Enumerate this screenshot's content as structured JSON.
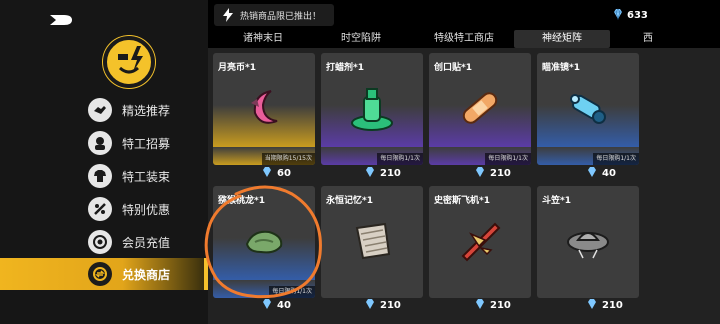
{
  "notice": {
    "text": "热销商品限已推出！"
  },
  "currency": {
    "amount": "633",
    "icon": "gem-icon"
  },
  "sidebar": {
    "items": [
      {
        "label": "精选推荐",
        "icon": "handshake-icon",
        "active": false
      },
      {
        "label": "特工招募",
        "icon": "agent-icon",
        "active": false
      },
      {
        "label": "特工装束",
        "icon": "outfit-icon",
        "active": false
      },
      {
        "label": "特别优惠",
        "icon": "discount-icon",
        "active": false
      },
      {
        "label": "会员充值",
        "icon": "member-icon",
        "active": false
      },
      {
        "label": "兑换商店",
        "icon": "exchange-icon",
        "active": true
      }
    ]
  },
  "tabs": [
    {
      "label": "诸神末日",
      "active": false
    },
    {
      "label": "时空陷阱",
      "active": false
    },
    {
      "label": "特级特工商店",
      "active": false
    },
    {
      "label": "神经矩阵",
      "active": true
    },
    {
      "label": "西",
      "active": false
    }
  ],
  "items": [
    {
      "name": "月亮币*1",
      "limit": "当期限购15/15次",
      "price": "60",
      "bg": "yellow",
      "icon": "moon-coin-icon"
    },
    {
      "name": "打蜡剂*1",
      "limit": "每日限购1/1次",
      "price": "210",
      "bg": "purple",
      "icon": "wax-bottle-icon"
    },
    {
      "name": "创口贴*1",
      "limit": "每日限购1/1次",
      "price": "210",
      "bg": "purple",
      "icon": "bandage-icon"
    },
    {
      "name": "瞄准镜*1",
      "limit": "每日限购1/1次",
      "price": "40",
      "bg": "blue",
      "icon": "scope-icon"
    },
    {
      "name": "猕猴桃龙*1",
      "limit": "每日限购1/1次",
      "price": "40",
      "bg": "blue",
      "icon": "kiwi-dragon-icon"
    },
    {
      "name": "永恒记忆*1",
      "limit": "",
      "price": "210",
      "bg": "none",
      "icon": "memory-icon"
    },
    {
      "name": "史密斯飞机*1",
      "limit": "",
      "price": "210",
      "bg": "none",
      "icon": "plane-icon"
    },
    {
      "name": "斗笠*1",
      "limit": "",
      "price": "210",
      "bg": "none",
      "icon": "hat-icon"
    }
  ],
  "colors": {
    "accent": "#f0b51f",
    "annotation": "#f07b2e",
    "gem": "#7fc8ff"
  }
}
